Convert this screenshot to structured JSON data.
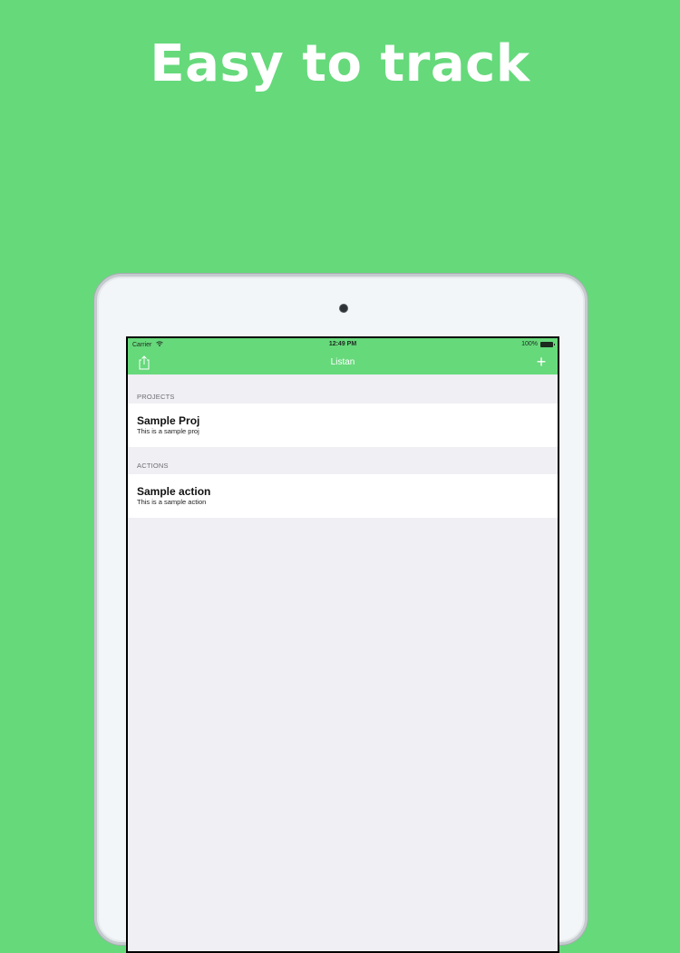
{
  "headline": "Easy to track",
  "status_bar": {
    "carrier": "Carrier",
    "time": "12:49 PM",
    "battery": "100%",
    "wifi_icon": "wifi-icon",
    "battery_icon": "battery-icon"
  },
  "nav_bar": {
    "title": "Listan",
    "left_icon": "share-icon",
    "right_icon": "plus-icon",
    "right_glyph": "+"
  },
  "sections": [
    {
      "header": "PROJECTS",
      "rows": [
        {
          "title": "Sample Proj",
          "subtitle": "This is a sample proj"
        }
      ]
    },
    {
      "header": "ACTIONS",
      "rows": [
        {
          "title": "Sample action",
          "subtitle": "This is a sample action"
        }
      ]
    }
  ],
  "colors": {
    "accent": "#66d97b",
    "table_background": "#efeff4",
    "row_background": "#ffffff",
    "device_frame": "#f3f6f8"
  }
}
